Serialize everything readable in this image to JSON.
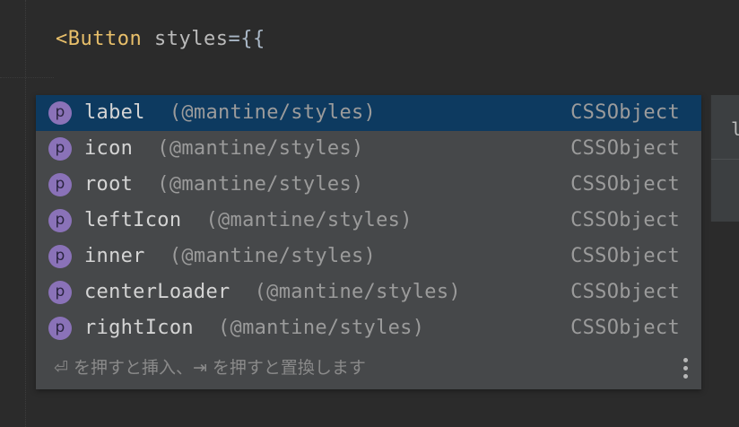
{
  "editor": {
    "code": {
      "tag_open": "<Button",
      "attr": "styles",
      "operator": "={{"
    }
  },
  "completion": {
    "badge_letter": "p",
    "items": [
      {
        "name": "label",
        "location": "(@mantine/styles)",
        "type": "CSSObject",
        "selected": true
      },
      {
        "name": "icon",
        "location": "(@mantine/styles)",
        "type": "CSSObject",
        "selected": false
      },
      {
        "name": "root",
        "location": "(@mantine/styles)",
        "type": "CSSObject",
        "selected": false
      },
      {
        "name": "leftIcon",
        "location": "(@mantine/styles)",
        "type": "CSSObject",
        "selected": false
      },
      {
        "name": "inner",
        "location": "(@mantine/styles)",
        "type": "CSSObject",
        "selected": false
      },
      {
        "name": "centerLoader",
        "location": "(@mantine/styles)",
        "type": "CSSObject",
        "selected": false
      },
      {
        "name": "rightIcon",
        "location": "(@mantine/styles)",
        "type": "CSSObject",
        "selected": false
      }
    ],
    "footer": {
      "enter_key": "⏎",
      "enter_text": " を押すと挿入、",
      "tab_key": "⇥",
      "tab_text": " を押すと置換します"
    }
  },
  "doc_popup": {
    "text": "l"
  },
  "colors": {
    "background": "#2b2b2b",
    "popup": "#46484a",
    "selection": "#0d3a60",
    "badge": "#8a72b8",
    "tag": "#e8bf6a"
  }
}
